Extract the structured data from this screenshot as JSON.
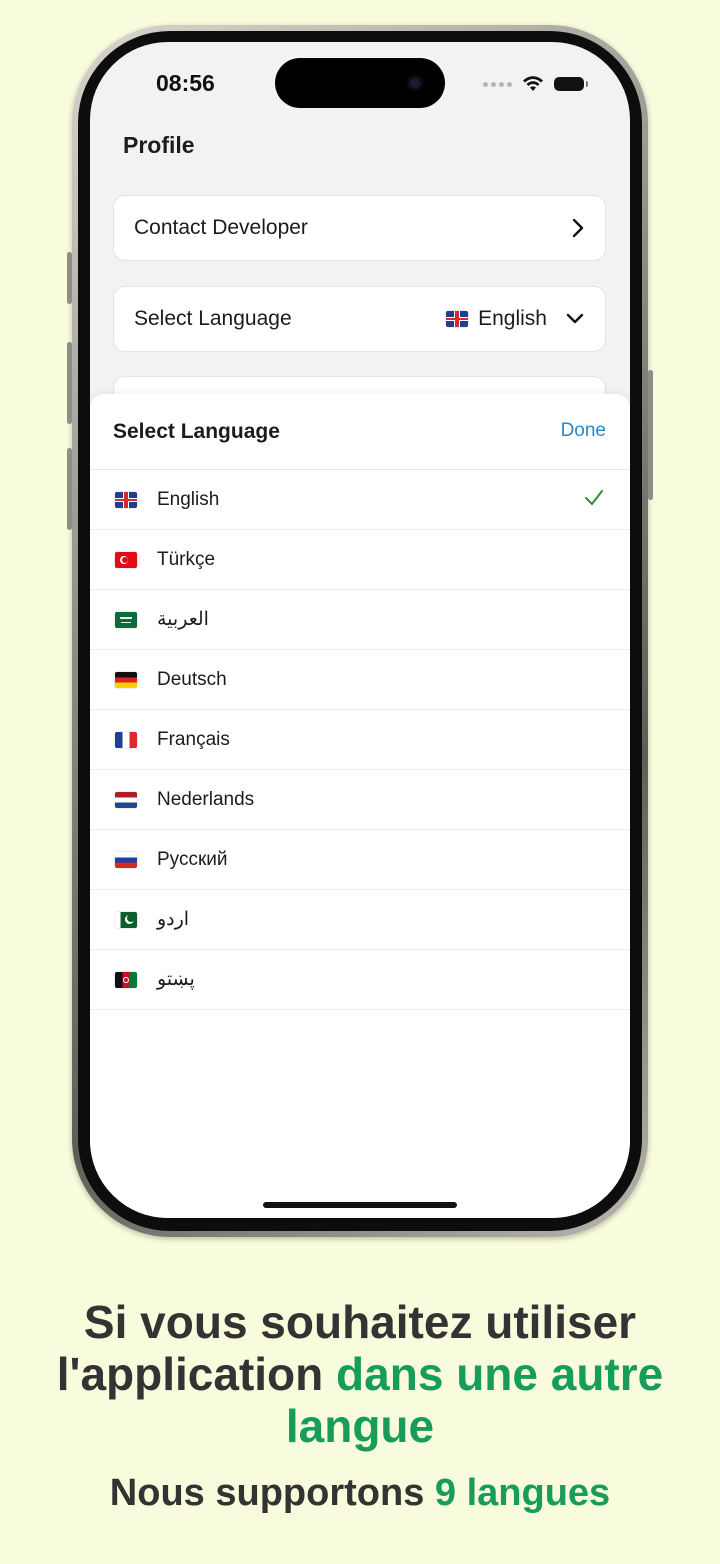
{
  "status_bar": {
    "time": "08:56"
  },
  "profile": {
    "title": "Profile",
    "contact_label": "Contact Developer",
    "language_label": "Select Language",
    "current_language": "English"
  },
  "sheet": {
    "title": "Select Language",
    "done_label": "Done",
    "languages": [
      {
        "name": "English",
        "flag": "gb-flag",
        "selected": true
      },
      {
        "name": "Türkçe",
        "flag": "tr-flag"
      },
      {
        "name": "العربية",
        "flag": "sa-flag"
      },
      {
        "name": "Deutsch",
        "flag": "de-flag"
      },
      {
        "name": "Français",
        "flag": "fr-flag"
      },
      {
        "name": "Nederlands",
        "flag": "nl-flag"
      },
      {
        "name": "Русский",
        "flag": "ru-flag"
      },
      {
        "name": "اردو",
        "flag": "pk-flag"
      },
      {
        "name": "پښتو",
        "flag": "af-flag"
      }
    ]
  },
  "marketing": {
    "headline_part1": "Si vous souhaitez utiliser l'application ",
    "headline_highlight": "dans une autre langue",
    "sub_part1": "Nous supportons ",
    "sub_highlight": "9 langues"
  },
  "colors": {
    "background": "#f8fcdc",
    "accent_green": "#179c5a",
    "link_blue": "#2a86c8",
    "check_green": "#2e8b3a"
  }
}
